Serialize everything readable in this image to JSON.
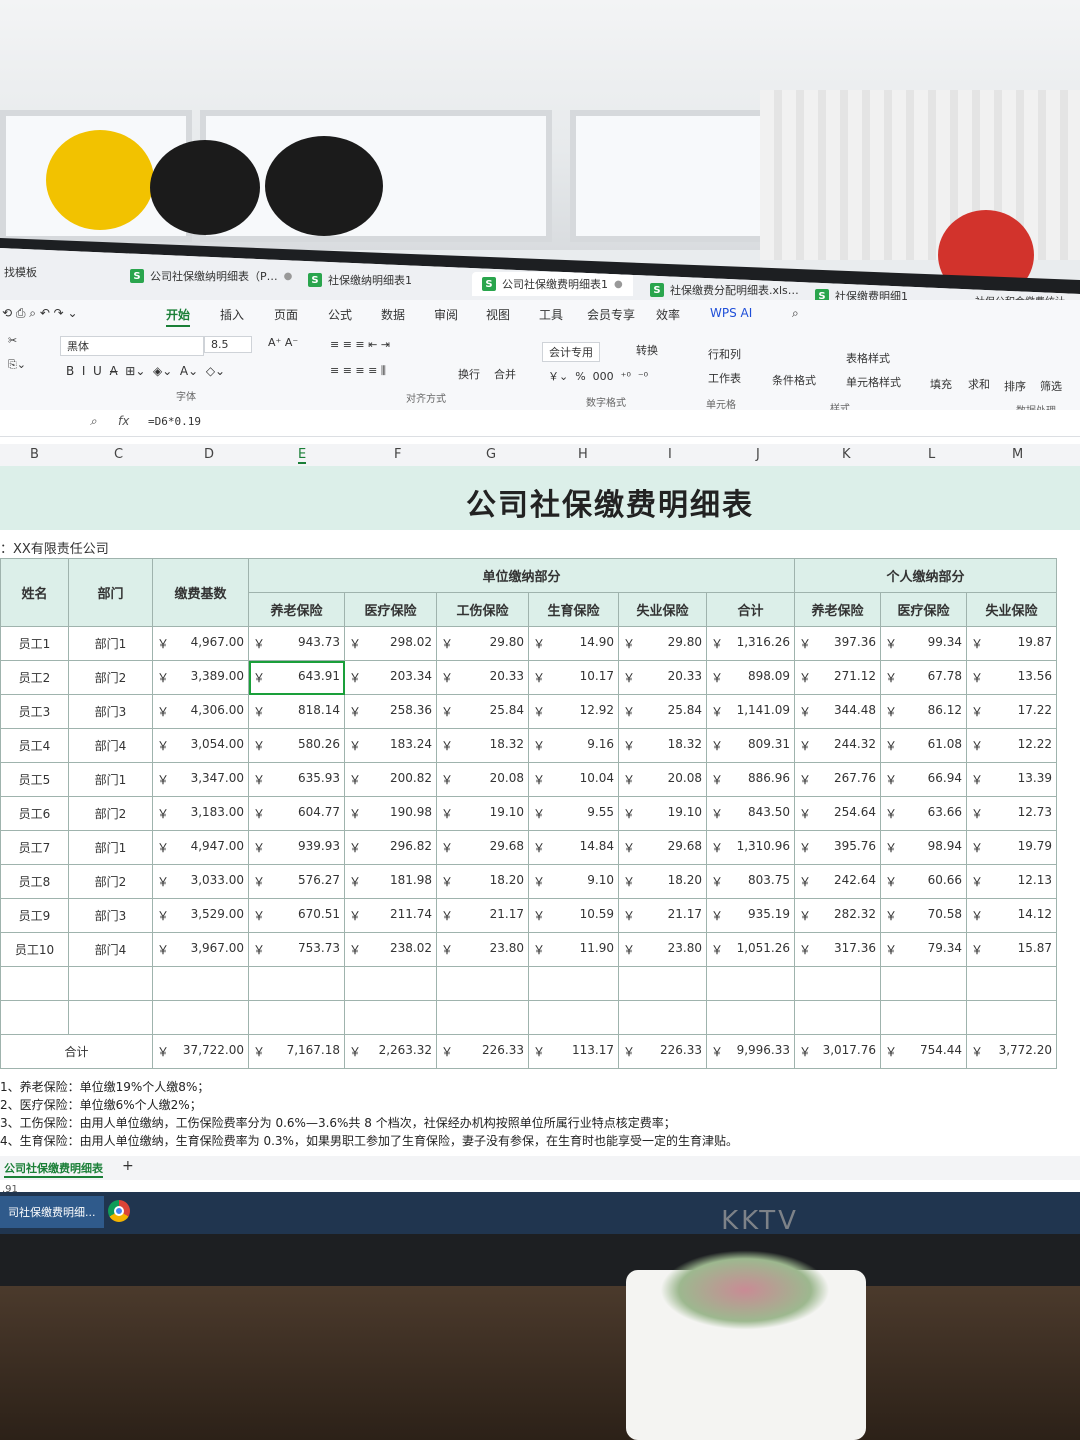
{
  "tabs": [
    {
      "label": "找模板",
      "active": false
    },
    {
      "label": "公司社保缴纳明细表（P…",
      "active": false
    },
    {
      "label": "社保缴纳明细表1",
      "active": false
    },
    {
      "label": "公司社保缴费明细表1",
      "active": true
    },
    {
      "label": "社保缴费分配明细表.xls…",
      "active": false
    },
    {
      "label": "社保缴费明细1",
      "active": false
    },
    {
      "label": "社保公积金缴费统计…",
      "active": false
    }
  ],
  "menu": [
    "开始",
    "插入",
    "页面",
    "公式",
    "数据",
    "审阅",
    "视图",
    "工具",
    "会员专享",
    "效率",
    "WPS AI"
  ],
  "ribbon": {
    "font_name": "黑体",
    "font_size": "8.5",
    "font_group": "字体",
    "align_group": "对齐方式",
    "wrap": "换行",
    "merge": "合并",
    "number_format": "会计专用",
    "convert": "转换",
    "number_group": "数字格式",
    "rows_cols": "行和列",
    "worksheet": "工作表",
    "cell_group": "单元格",
    "cond_format": "条件格式",
    "table_style": "表格样式",
    "cell_style": "单元格样式",
    "style_group": "样式",
    "fill": "填充",
    "sum": "求和",
    "sort": "排序",
    "filter": "筛选",
    "data_group": "数据处理"
  },
  "formula": "=D6*0.19",
  "columns": [
    "B",
    "C",
    "D",
    "E",
    "F",
    "G",
    "H",
    "I",
    "J",
    "K",
    "L",
    "M"
  ],
  "selected_column": "E",
  "sheet": {
    "title": "公司社保缴费明细表",
    "company": "：XX有限责任公司",
    "group_unit": "单位缴纳部分",
    "group_personal": "个人缴纳部分",
    "h_name": "姓名",
    "h_dept": "部门",
    "h_base": "缴费基数",
    "h_pension": "养老保险",
    "h_medical": "医疗保险",
    "h_injury": "工伤保险",
    "h_maternity": "生育保险",
    "h_unemployment": "失业保险",
    "h_subtotal": "合计",
    "h_p_pension": "养老保险",
    "h_p_medical": "医疗保险",
    "h_p_unemployment": "失业保险",
    "currency": "￥",
    "rows": [
      {
        "name": "员工1",
        "dept": "部门1",
        "base": "4,967.00",
        "pension": "943.73",
        "medical": "298.02",
        "injury": "29.80",
        "maternity": "14.90",
        "unemp": "29.80",
        "sum": "1,316.26",
        "p_pension": "397.36",
        "p_medical": "99.34",
        "p_unemp": "19.87"
      },
      {
        "name": "员工2",
        "dept": "部门2",
        "base": "3,389.00",
        "pension": "643.91",
        "medical": "203.34",
        "injury": "20.33",
        "maternity": "10.17",
        "unemp": "20.33",
        "sum": "898.09",
        "p_pension": "271.12",
        "p_medical": "67.78",
        "p_unemp": "13.56"
      },
      {
        "name": "员工3",
        "dept": "部门3",
        "base": "4,306.00",
        "pension": "818.14",
        "medical": "258.36",
        "injury": "25.84",
        "maternity": "12.92",
        "unemp": "25.84",
        "sum": "1,141.09",
        "p_pension": "344.48",
        "p_medical": "86.12",
        "p_unemp": "17.22"
      },
      {
        "name": "员工4",
        "dept": "部门4",
        "base": "3,054.00",
        "pension": "580.26",
        "medical": "183.24",
        "injury": "18.32",
        "maternity": "9.16",
        "unemp": "18.32",
        "sum": "809.31",
        "p_pension": "244.32",
        "p_medical": "61.08",
        "p_unemp": "12.22"
      },
      {
        "name": "员工5",
        "dept": "部门1",
        "base": "3,347.00",
        "pension": "635.93",
        "medical": "200.82",
        "injury": "20.08",
        "maternity": "10.04",
        "unemp": "20.08",
        "sum": "886.96",
        "p_pension": "267.76",
        "p_medical": "66.94",
        "p_unemp": "13.39"
      },
      {
        "name": "员工6",
        "dept": "部门2",
        "base": "3,183.00",
        "pension": "604.77",
        "medical": "190.98",
        "injury": "19.10",
        "maternity": "9.55",
        "unemp": "19.10",
        "sum": "843.50",
        "p_pension": "254.64",
        "p_medical": "63.66",
        "p_unemp": "12.73"
      },
      {
        "name": "员工7",
        "dept": "部门1",
        "base": "4,947.00",
        "pension": "939.93",
        "medical": "296.82",
        "injury": "29.68",
        "maternity": "14.84",
        "unemp": "29.68",
        "sum": "1,310.96",
        "p_pension": "395.76",
        "p_medical": "98.94",
        "p_unemp": "19.79"
      },
      {
        "name": "员工8",
        "dept": "部门2",
        "base": "3,033.00",
        "pension": "576.27",
        "medical": "181.98",
        "injury": "18.20",
        "maternity": "9.10",
        "unemp": "18.20",
        "sum": "803.75",
        "p_pension": "242.64",
        "p_medical": "60.66",
        "p_unemp": "12.13"
      },
      {
        "name": "员工9",
        "dept": "部门3",
        "base": "3,529.00",
        "pension": "670.51",
        "medical": "211.74",
        "injury": "21.17",
        "maternity": "10.59",
        "unemp": "21.17",
        "sum": "935.19",
        "p_pension": "282.32",
        "p_medical": "70.58",
        "p_unemp": "14.12"
      },
      {
        "name": "员工10",
        "dept": "部门4",
        "base": "3,967.00",
        "pension": "753.73",
        "medical": "238.02",
        "injury": "23.80",
        "maternity": "11.90",
        "unemp": "23.80",
        "sum": "1,051.26",
        "p_pension": "317.36",
        "p_medical": "79.34",
        "p_unemp": "15.87"
      }
    ],
    "total": {
      "label": "合计",
      "base": "37,722.00",
      "pension": "7,167.18",
      "medical": "2,263.32",
      "injury": "226.33",
      "maternity": "113.17",
      "unemp": "226.33",
      "sum": "9,996.33",
      "p_pension": "3,017.76",
      "p_medical": "754.44",
      "p_unemp": "3,772.20"
    },
    "notes": [
      "1、养老保险：单位缴19%个人缴8%；",
      "2、医疗保险：单位缴6%个人缴2%；",
      "3、工伤保险：由用人单位缴纳，工伤保险费率分为 0.6%—3.6%共 8 个档次，社保经办机构按照单位所属行业特点核定费率；",
      "4、生育保险：由用人单位缴纳，生育保险费率为 0.3%，如果男职工参加了生育保险，妻子没有参保，在生育时也能享受一定的生育津贴。"
    ]
  },
  "sheet_tab": "公司社保缴费明细表",
  "status_text": ".91",
  "taskbar_item": "司社保缴费明细...",
  "monitor_brand": "KKTV"
}
